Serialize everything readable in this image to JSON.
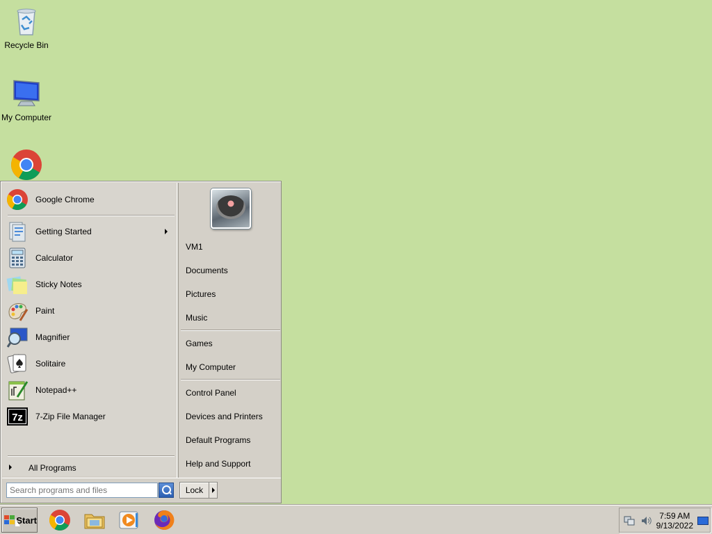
{
  "desktop": {
    "icons": [
      {
        "label": "Recycle Bin",
        "icon": "recycle-bin-icon"
      },
      {
        "label": "My Computer",
        "icon": "computer-icon"
      },
      {
        "label": "",
        "icon": "chrome-shortcut-icon"
      }
    ],
    "background_color": "#c5df9f"
  },
  "start_menu": {
    "pinned": [
      {
        "label": "Google Chrome",
        "icon": "chrome-icon"
      }
    ],
    "recent": [
      {
        "label": "Getting Started",
        "icon": "getting-started-icon",
        "has_submenu": true
      },
      {
        "label": "Calculator",
        "icon": "calculator-icon"
      },
      {
        "label": "Sticky Notes",
        "icon": "sticky-notes-icon"
      },
      {
        "label": "Paint",
        "icon": "paint-icon"
      },
      {
        "label": "Magnifier",
        "icon": "magnifier-icon"
      },
      {
        "label": "Solitaire",
        "icon": "solitaire-icon"
      },
      {
        "label": "Notepad++",
        "icon": "notepadpp-icon"
      },
      {
        "label": "7-Zip File Manager",
        "icon": "7zip-icon"
      }
    ],
    "all_programs": "All Programs",
    "right": {
      "user": "VM1",
      "group1": [
        "Documents",
        "Pictures",
        "Music"
      ],
      "group2": [
        "Games",
        "My Computer"
      ],
      "group3": [
        "Control Panel",
        "Devices and Printers",
        "Default Programs",
        "Help and Support"
      ]
    },
    "search": {
      "placeholder": "Search programs and files"
    },
    "lock_label": "Lock"
  },
  "taskbar": {
    "start_label": "Start",
    "pinned": [
      "chrome-icon",
      "file-explorer-icon",
      "media-player-icon",
      "firefox-icon"
    ],
    "clock": {
      "time": "7:59 AM",
      "date": "9/13/2022"
    }
  }
}
